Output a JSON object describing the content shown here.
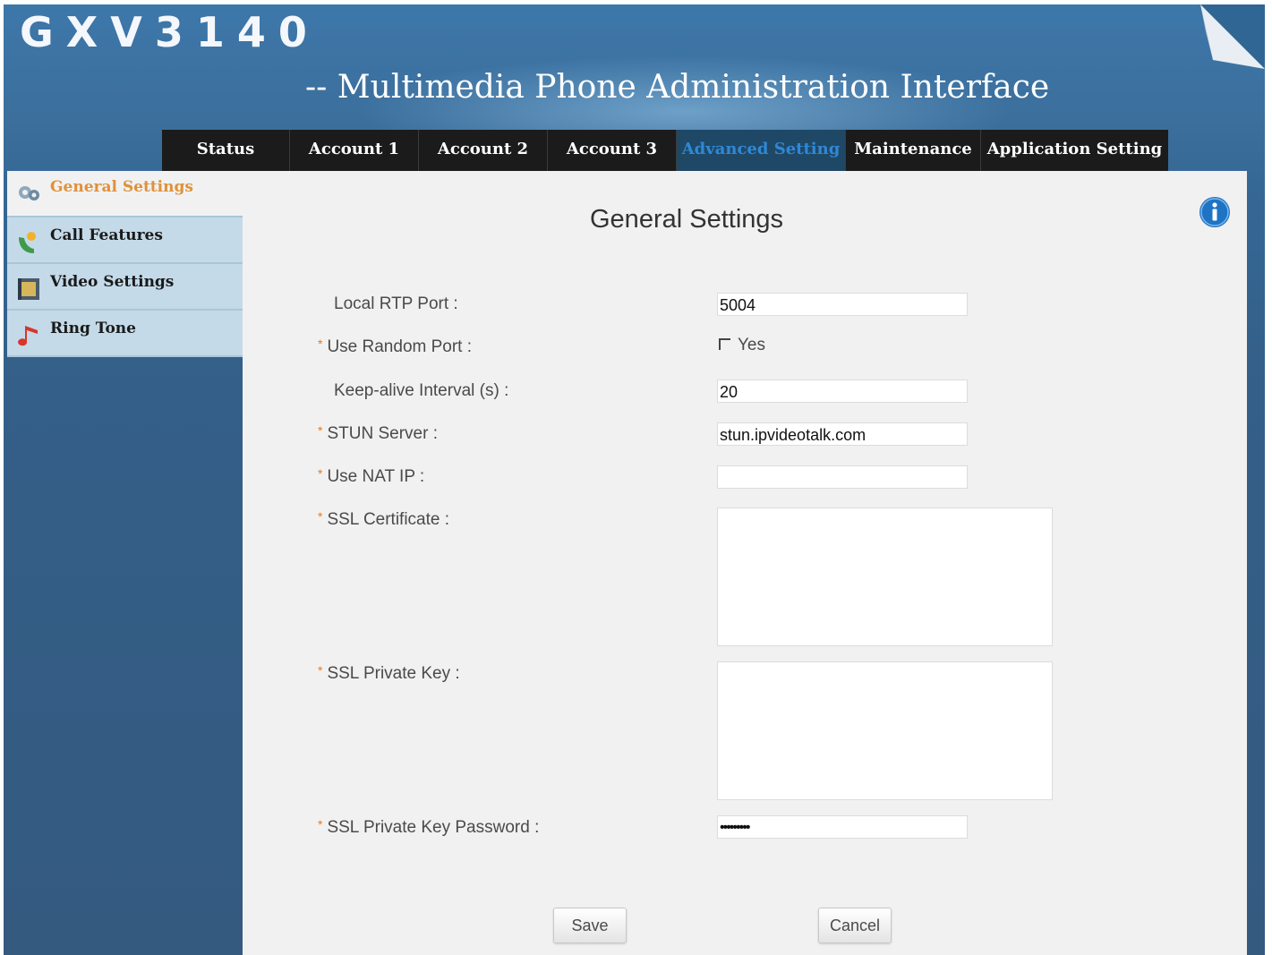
{
  "header": {
    "brand": "GXV3140",
    "subtitle": "-- Multimedia Phone Administration Interface"
  },
  "nav": {
    "tabs": [
      {
        "label": "Status"
      },
      {
        "label": "Account 1"
      },
      {
        "label": "Account 2"
      },
      {
        "label": "Account 3"
      },
      {
        "label": "Advanced Setting",
        "active": true
      },
      {
        "label": "Maintenance"
      },
      {
        "label": "Application Setting"
      }
    ]
  },
  "sidebar": {
    "items": [
      {
        "label": "General Settings",
        "icon": "gears-icon",
        "active": true
      },
      {
        "label": "Call Features",
        "icon": "user-phone-icon"
      },
      {
        "label": "Video Settings",
        "icon": "film-icon"
      },
      {
        "label": "Ring Tone",
        "icon": "music-note-icon"
      }
    ]
  },
  "content": {
    "title": "General Settings",
    "info_icon": "info-icon",
    "required_mark": "*",
    "fields": {
      "local_rtp_port": {
        "label": "Local RTP Port :",
        "value": "5004"
      },
      "use_random_port": {
        "label": "Use Random Port :",
        "option": "Yes",
        "checked": false
      },
      "keep_alive": {
        "label": "Keep-alive Interval (s) :",
        "value": "20"
      },
      "stun_server": {
        "label": "STUN Server :",
        "value": "stun.ipvideotalk.com"
      },
      "use_nat_ip": {
        "label": "Use NAT IP :",
        "value": ""
      },
      "ssl_certificate": {
        "label": "SSL Certificate :",
        "value": ""
      },
      "ssl_private_key": {
        "label": "SSL Private Key :",
        "value": ""
      },
      "ssl_private_key_password": {
        "label": "SSL Private Key Password :",
        "value": "•••••••••"
      }
    },
    "buttons": {
      "save": "Save",
      "cancel": "Cancel"
    }
  },
  "colors": {
    "accent_active_tab": "#2f88d6",
    "active_sidebar_text": "#e0913a",
    "required_star": "#e07b2a",
    "nav_bg": "#1b1b1b",
    "sidebar_item_bg": "#c4dae9"
  }
}
